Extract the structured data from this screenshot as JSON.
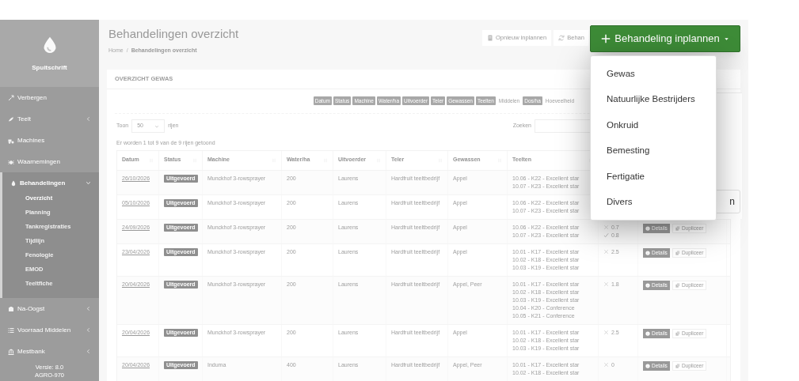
{
  "sidebar": {
    "brand": "Spuitschrift",
    "items": [
      {
        "label": "Verbergen",
        "kind": "link"
      },
      {
        "label": "Teelt",
        "kind": "group",
        "expanded": false
      },
      {
        "label": "Machines",
        "kind": "link"
      },
      {
        "label": "Waarnemingen",
        "kind": "link"
      },
      {
        "label": "Behandelingen",
        "kind": "group",
        "expanded": true,
        "children": [
          {
            "label": "Overzicht",
            "selected": true
          },
          {
            "label": "Planning",
            "selected": false
          },
          {
            "label": "Tankregistraties",
            "selected": false
          },
          {
            "label": "Tijdlijn",
            "selected": false
          },
          {
            "label": "Fenologie",
            "selected": false
          },
          {
            "label": "EMOD",
            "selected": false
          },
          {
            "label": "Teeltfiche",
            "selected": false
          }
        ]
      },
      {
        "label": "Na-Oogst",
        "kind": "group",
        "expanded": false
      },
      {
        "label": "Voorraad Middelen",
        "kind": "group",
        "expanded": false
      },
      {
        "label": "Mestbank",
        "kind": "group",
        "expanded": false
      }
    ],
    "version": [
      "Versie: 8.0",
      "AGRO-970"
    ]
  },
  "header": {
    "title": "Behandelingen overzicht",
    "breadcrumb": [
      "Home",
      "Behandelingen overzicht"
    ],
    "breadcrumb_separator": "/",
    "buttons": [
      "Opnieuw inplannen",
      "Behan"
    ]
  },
  "plan_button": {
    "label": "Behandeling inplannen",
    "expanded": true,
    "menu": [
      "Gewas",
      "Natuurlijke Bestrijders",
      "Onkruid",
      "Bemesting",
      "Fertigatie",
      "Divers"
    ]
  },
  "side_panel": {
    "button": "n"
  },
  "card": {
    "title": "OVERZICHT GEWAS",
    "column_toggles": [
      {
        "label": "Datum",
        "on": true
      },
      {
        "label": "Status",
        "on": true
      },
      {
        "label": "Machine",
        "on": true
      },
      {
        "label": "Water/ha",
        "on": true
      },
      {
        "label": "Uitvoerder",
        "on": true
      },
      {
        "label": "Teler",
        "on": true
      },
      {
        "label": "Gewassen",
        "on": true
      },
      {
        "label": "Teelten",
        "on": true
      },
      {
        "label": "Middelen",
        "on": false
      },
      {
        "label": "Dos/ha",
        "on": true
      },
      {
        "label": "Hoeveelheid",
        "on": false
      }
    ],
    "length": {
      "before": "Toon",
      "value": "50",
      "after": "rijen"
    },
    "search_label": "Zoeken",
    "info": "Er worden 1 tot 9 van de 9 rijen getoond",
    "table": {
      "columns": [
        "Datum",
        "Status",
        "Machine",
        "Water/ha",
        "Uitvoerder",
        "Teler",
        "Gewassen",
        "Teelten"
      ],
      "rows": [
        {
          "datum": "26/10/2026",
          "status": "Uitgevoerd",
          "machine": "Munckhof 3-rowsprayer",
          "water": "200",
          "uitvoerder": "Laurens",
          "teler": "Hardfruit teeltbedrijf",
          "gewassen": "Appel",
          "teelten": [
            "10.06 - K22 - Excellent star",
            "10.07 - K23 - Excellent star"
          ]
        },
        {
          "datum": "05/10/2026",
          "status": "Uitgevoerd",
          "machine": "Munckhof 3-rowsprayer",
          "water": "200",
          "uitvoerder": "Laurens",
          "teler": "Hardfruit teeltbedrijf",
          "gewassen": "Appel",
          "teelten": [
            "10.06 - K22 - Excellent star",
            "10.07 - K23 - Excellent star"
          ]
        },
        {
          "datum": "24/09/2026",
          "status": "Uitgevoerd",
          "machine": "Munckhof 3-rowsprayer",
          "water": "200",
          "uitvoerder": "Laurens",
          "teler": "Hardfruit teeltbedrijf",
          "gewassen": "Appel",
          "teelten": [
            "10.06 - K22 - Excellent star",
            "10.07 - K23 - Excellent star"
          ],
          "column_9": [
            {
              "kind": "cross",
              "value": "0.7"
            },
            {
              "kind": "check",
              "value": "0.8"
            }
          ],
          "actions": [
            "Details",
            "Dupliceer"
          ]
        },
        {
          "datum": "23/04/2026",
          "status": "Uitgevoerd",
          "machine": "Munckhof 3-rowsprayer",
          "water": "200",
          "uitvoerder": "Laurens",
          "teler": "Hardfruit teeltbedrijf",
          "gewassen": "Appel",
          "teelten": [
            "10.01 - K17 - Excellent star",
            "10.02 - K18 - Excellent star",
            "10.03 - K19 - Excellent star"
          ],
          "column_9": [
            {
              "kind": "cross",
              "value": "2.5"
            }
          ],
          "actions": [
            "Details",
            "Dupliceer"
          ]
        },
        {
          "datum": "20/04/2026",
          "status": "Uitgevoerd",
          "machine": "Munckhof 3-rowsprayer",
          "water": "200",
          "uitvoerder": "Laurens",
          "teler": "Hardfruit teeltbedrijf",
          "gewassen": "Appel, Peer",
          "teelten": [
            "10.01 - K17 - Excellent star",
            "10.02 - K18 - Excellent star",
            "10.03 - K19 - Excellent star",
            "10.04 - K20 - Conference",
            "10.05 - K21 - Conference"
          ],
          "column_9": [
            {
              "kind": "cross",
              "value": "1.8"
            }
          ],
          "actions": [
            "Details",
            "Dupliceer"
          ]
        },
        {
          "datum": "20/04/2026",
          "status": "Uitgevoerd",
          "machine": "Munckhof 3-rowsprayer",
          "water": "200",
          "uitvoerder": "Laurens",
          "teler": "Hardfruit teeltbedrijf",
          "gewassen": "Appel",
          "teelten": [
            "10.01 - K17 - Excellent star",
            "10.02 - K18 - Excellent star",
            "10.03 - K19 - Excellent star"
          ],
          "column_9": [
            {
              "kind": "cross",
              "value": "2.5"
            }
          ],
          "actions": [
            "Details",
            "Dupliceer"
          ]
        },
        {
          "datum": "20/04/2026",
          "status": "Uitgevoerd",
          "machine": "Induma",
          "water": "400",
          "uitvoerder": "Laurens",
          "teler": "Hardfruit teeltbedrijf",
          "gewassen": "Appel, Peer",
          "teelten": [
            "10.01 - K17 - Excellent star",
            "10.02 - K18 - Excellent star"
          ],
          "column_9": [
            {
              "kind": "cross",
              "value": "0"
            }
          ],
          "actions": [
            "Details",
            "Dupliceer"
          ]
        }
      ]
    }
  }
}
